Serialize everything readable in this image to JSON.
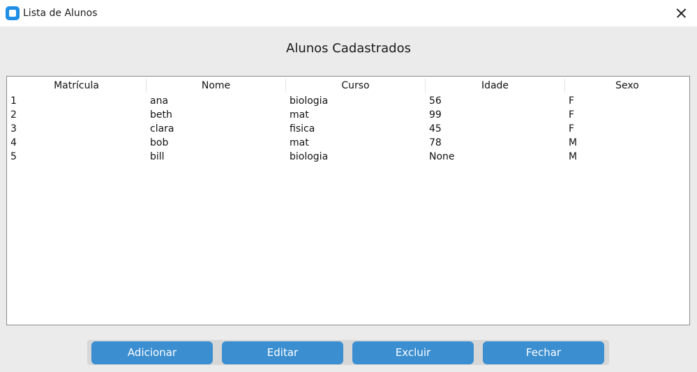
{
  "window": {
    "title": "Lista de Alunos"
  },
  "page": {
    "title": "Alunos Cadastrados"
  },
  "table": {
    "columns": [
      "Matrícula",
      "Nome",
      "Curso",
      "Idade",
      "Sexo"
    ],
    "rows": [
      [
        "1",
        "ana",
        "biologia",
        "56",
        "F"
      ],
      [
        "2",
        "beth",
        "mat",
        "99",
        "F"
      ],
      [
        "3",
        "clara",
        "fisica",
        "45",
        "F"
      ],
      [
        "4",
        "bob",
        "mat",
        "78",
        "M"
      ],
      [
        "5",
        "bill",
        "biologia",
        "None",
        "M"
      ]
    ]
  },
  "buttons": {
    "add": "Adicionar",
    "edit": "Editar",
    "delete": "Excluir",
    "close": "Fechar"
  },
  "colors": {
    "accent": "#3b8ed0",
    "app_icon": "#1f8ee6"
  },
  "icons": {
    "app": "app-icon",
    "close": "close-icon"
  }
}
